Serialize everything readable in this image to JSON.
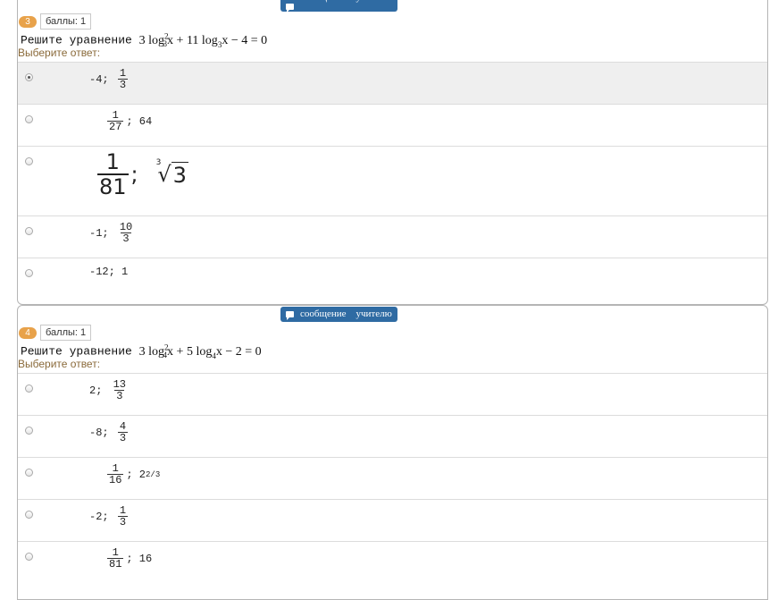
{
  "message_button": {
    "word1": "сообщение",
    "word2": "учителю"
  },
  "questions": [
    {
      "number": "3",
      "score_label": "баллы: 1",
      "prompt_text": "Решите уравнение",
      "equation": {
        "a": "3",
        "log1": "log",
        "base1": "3",
        "pow": "2",
        "x1": "x",
        "plus": "+",
        "b": "11",
        "log2": "log",
        "base2": "3",
        "x2": "x",
        "minus": "−",
        "c": "4",
        "eq": "=",
        "rhs": "0"
      },
      "select_prompt": "Выберите ответ:",
      "options": [
        {
          "selected": true,
          "pre": "-4;",
          "num": "1",
          "den": "3",
          "post": ""
        },
        {
          "selected": false,
          "pre": "",
          "num": "1",
          "den": "27",
          "post": "; 64"
        },
        {
          "selected": false,
          "pre": "",
          "num": "1",
          "den": "81",
          "post": ";",
          "root_index": "3",
          "root_sym": "√",
          "root_val": "3"
        },
        {
          "selected": false,
          "pre": "-1;",
          "num": "10",
          "den": "3",
          "post": ""
        },
        {
          "selected": false,
          "text": "-12; 1"
        }
      ]
    },
    {
      "number": "4",
      "score_label": "баллы: 1",
      "prompt_text": "Решите уравнение",
      "equation": {
        "a": "3",
        "log1": "log",
        "base1": "4",
        "pow": "2",
        "x1": "x",
        "plus": "+",
        "b": "5",
        "log2": "log",
        "base2": "4",
        "x2": "x",
        "minus": "−",
        "c": "2",
        "eq": "=",
        "rhs": "0"
      },
      "select_prompt": "Выберите ответ:",
      "options": [
        {
          "selected": false,
          "pre": "2;",
          "num": "13",
          "den": "3",
          "post": ""
        },
        {
          "selected": false,
          "pre": "-8;",
          "num": "4",
          "den": "3",
          "post": ""
        },
        {
          "selected": false,
          "pre": "",
          "num": "1",
          "den": "16",
          "post": "; 2",
          "sup": "2/3"
        },
        {
          "selected": false,
          "pre": "-2;",
          "num": "1",
          "den": "3",
          "post": ""
        },
        {
          "selected": false,
          "pre": "",
          "num": "1",
          "den": "81",
          "post": "; 16"
        }
      ]
    }
  ]
}
